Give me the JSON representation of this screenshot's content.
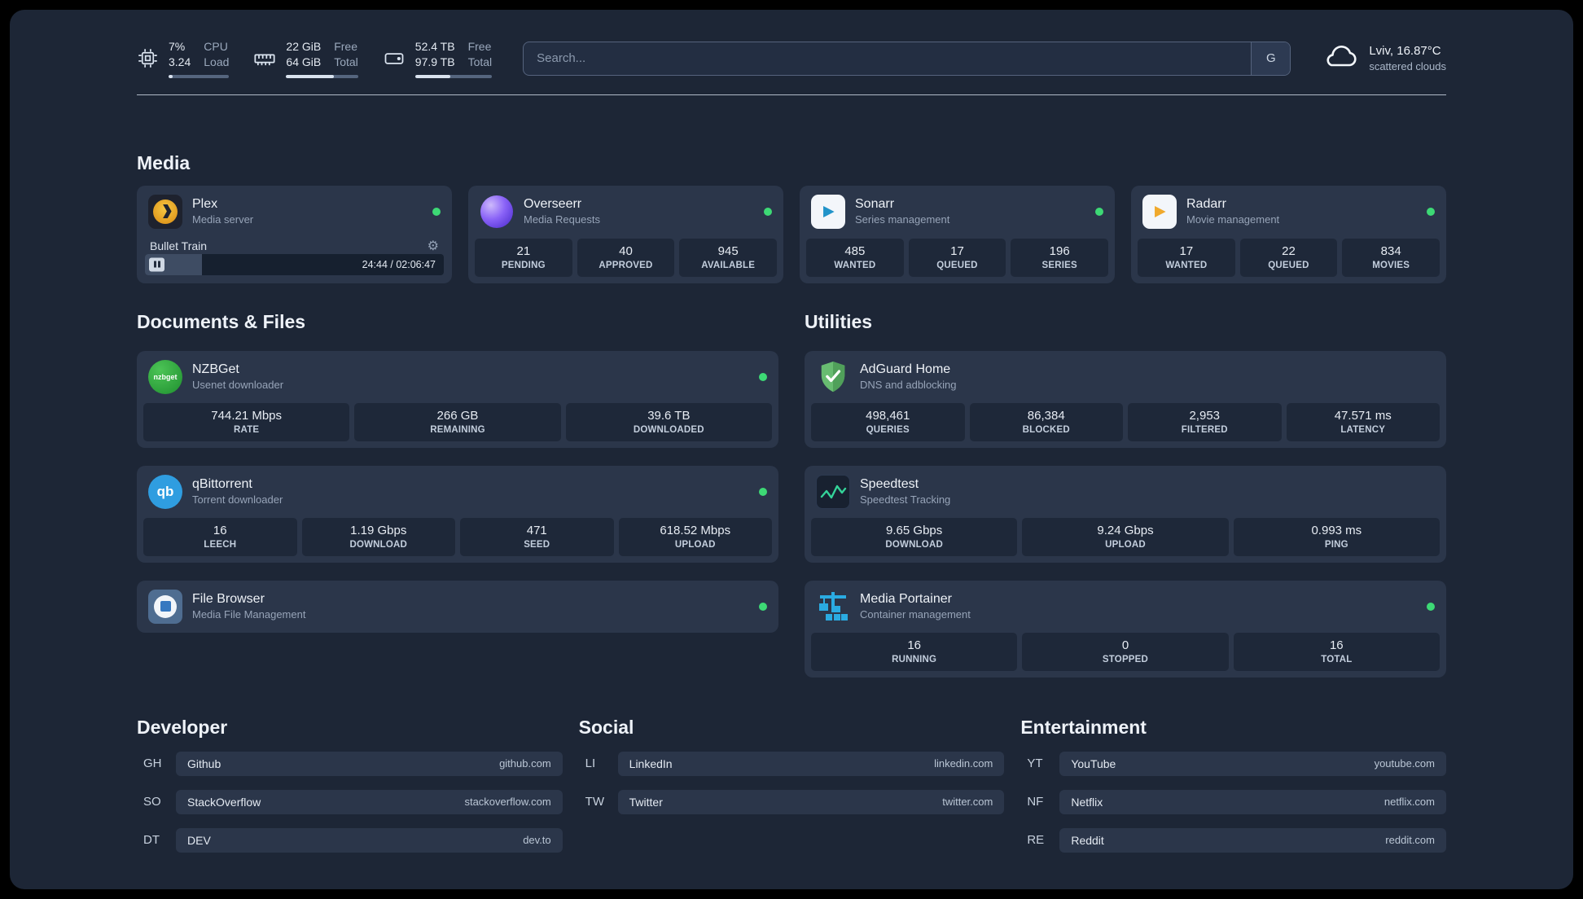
{
  "colors": {
    "status_online": "#3dd975",
    "background": "#1d2636",
    "card": "#2b364a",
    "stat_box": "#1e2839"
  },
  "topbar": {
    "cpu": {
      "value_top": "7%",
      "value_bottom": "3.24",
      "label_top": "CPU",
      "label_bottom": "Load",
      "bar_pct": 7
    },
    "ram": {
      "value_top": "22 GiB",
      "value_bottom": "64 GiB",
      "label_top": "Free",
      "label_bottom": "Total",
      "bar_pct": 66
    },
    "disk": {
      "value_top": "52.4 TB",
      "value_bottom": "97.9 TB",
      "label_top": "Free",
      "label_bottom": "Total",
      "bar_pct": 46
    },
    "search": {
      "placeholder": "Search...",
      "button_label": "G"
    },
    "weather": {
      "location": "Lviv, 16.87°C",
      "condition": "scattered clouds"
    }
  },
  "sections": {
    "media": "Media",
    "documents": "Documents & Files",
    "utilities": "Utilities",
    "developer": "Developer",
    "social": "Social",
    "entertainment": "Entertainment"
  },
  "services": {
    "plex": {
      "name": "Plex",
      "desc": "Media server",
      "now_playing": "Bullet Train",
      "time": "24:44 / 02:06:47",
      "progress_pct": 19
    },
    "overseerr": {
      "name": "Overseerr",
      "desc": "Media Requests",
      "stats": [
        {
          "value": "21",
          "label": "PENDING"
        },
        {
          "value": "40",
          "label": "APPROVED"
        },
        {
          "value": "945",
          "label": "AVAILABLE"
        }
      ]
    },
    "sonarr": {
      "name": "Sonarr",
      "desc": "Series management",
      "stats": [
        {
          "value": "485",
          "label": "WANTED"
        },
        {
          "value": "17",
          "label": "QUEUED"
        },
        {
          "value": "196",
          "label": "SERIES"
        }
      ]
    },
    "radarr": {
      "name": "Radarr",
      "desc": "Movie management",
      "stats": [
        {
          "value": "17",
          "label": "WANTED"
        },
        {
          "value": "22",
          "label": "QUEUED"
        },
        {
          "value": "834",
          "label": "MOVIES"
        }
      ]
    },
    "nzbget": {
      "name": "NZBGet",
      "desc": "Usenet downloader",
      "icon_text": "nzbget",
      "stats": [
        {
          "value": "744.21 Mbps",
          "label": "RATE"
        },
        {
          "value": "266 GB",
          "label": "REMAINING"
        },
        {
          "value": "39.6 TB",
          "label": "DOWNLOADED"
        }
      ]
    },
    "qbittorrent": {
      "name": "qBittorrent",
      "desc": "Torrent downloader",
      "icon_text": "qb",
      "stats": [
        {
          "value": "16",
          "label": "LEECH"
        },
        {
          "value": "1.19 Gbps",
          "label": "DOWNLOAD"
        },
        {
          "value": "471",
          "label": "SEED"
        },
        {
          "value": "618.52 Mbps",
          "label": "UPLOAD"
        }
      ]
    },
    "filebrowser": {
      "name": "File Browser",
      "desc": "Media File Management"
    },
    "adguard": {
      "name": "AdGuard Home",
      "desc": "DNS and adblocking",
      "stats": [
        {
          "value": "498,461",
          "label": "QUERIES"
        },
        {
          "value": "86,384",
          "label": "BLOCKED"
        },
        {
          "value": "2,953",
          "label": "FILTERED"
        },
        {
          "value": "47.571 ms",
          "label": "LATENCY"
        }
      ]
    },
    "speedtest": {
      "name": "Speedtest",
      "desc": "Speedtest Tracking",
      "stats": [
        {
          "value": "9.65 Gbps",
          "label": "DOWNLOAD"
        },
        {
          "value": "9.24 Gbps",
          "label": "UPLOAD"
        },
        {
          "value": "0.993 ms",
          "label": "PING"
        }
      ]
    },
    "portainer": {
      "name": "Media Portainer",
      "desc": "Container management",
      "stats": [
        {
          "value": "16",
          "label": "RUNNING"
        },
        {
          "value": "0",
          "label": "STOPPED"
        },
        {
          "value": "16",
          "label": "TOTAL"
        }
      ]
    }
  },
  "bookmarks": {
    "developer": [
      {
        "abbr": "GH",
        "name": "Github",
        "url": "github.com"
      },
      {
        "abbr": "SO",
        "name": "StackOverflow",
        "url": "stackoverflow.com"
      },
      {
        "abbr": "DT",
        "name": "DEV",
        "url": "dev.to"
      }
    ],
    "social": [
      {
        "abbr": "LI",
        "name": "LinkedIn",
        "url": "linkedin.com"
      },
      {
        "abbr": "TW",
        "name": "Twitter",
        "url": "twitter.com"
      }
    ],
    "entertainment": [
      {
        "abbr": "YT",
        "name": "YouTube",
        "url": "youtube.com"
      },
      {
        "abbr": "NF",
        "name": "Netflix",
        "url": "netflix.com"
      },
      {
        "abbr": "RE",
        "name": "Reddit",
        "url": "reddit.com"
      }
    ]
  }
}
